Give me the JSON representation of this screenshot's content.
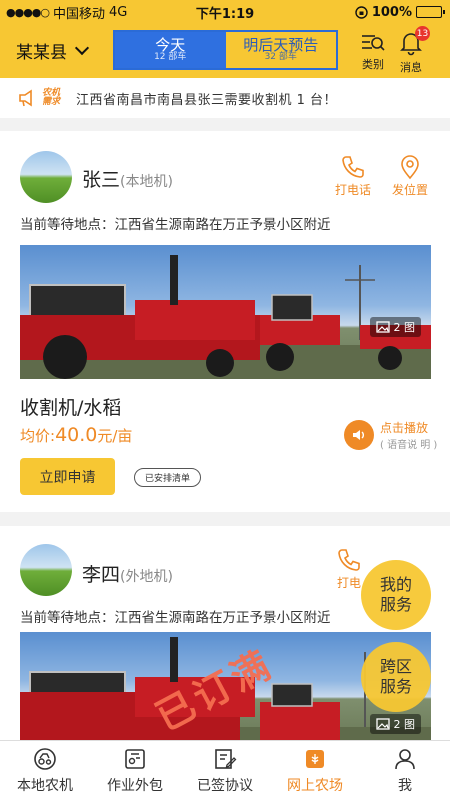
{
  "status": {
    "signal": "●●●●○",
    "carrier": "中国移动",
    "network": "4G",
    "time": "下午1:19",
    "battery": "100%"
  },
  "header": {
    "region": "某某县",
    "tabs": [
      {
        "label": "今天",
        "sub": "12 部车"
      },
      {
        "label": "明后天预告",
        "sub": "32 部车"
      }
    ],
    "category_label": "类别",
    "message_label": "消息",
    "message_badge": "13"
  },
  "notice": {
    "tag": "农机需求",
    "text": "江西省南昌市南昌县张三需要收割机 1 台！"
  },
  "cards": [
    {
      "name": "张三",
      "location_type": "(本地机)",
      "call_label": "打电话",
      "position_label": "发位置",
      "waiting": "当前等待地点：江西省生源南路在万正予景小区附近",
      "photo_count": "2 图",
      "title": "收割机/水稻",
      "price_prefix": "均价:",
      "price_value": "40.0",
      "price_unit": "元/亩",
      "play_label": "点击播放",
      "play_sub": "( 语音说 明 )",
      "apply_label": "立即申请",
      "arranged_label": "已安排清单"
    },
    {
      "name": "李四",
      "location_type": "(外地机)",
      "call_label": "打电",
      "waiting": "当前等待地点：江西省生源南路在万正予景小区附近",
      "photo_count": "2 图",
      "stamp": "已订满"
    }
  ],
  "fabs": {
    "my_service": "我的服务",
    "cross_region": "跨区服务"
  },
  "tabbar": [
    {
      "label": "本地农机"
    },
    {
      "label": "作业外包"
    },
    {
      "label": "已签协议"
    },
    {
      "label": "网上农场"
    },
    {
      "label": "我"
    }
  ],
  "colors": {
    "brand_yellow": "#f7c733",
    "accent_orange": "#ef8a26",
    "active_blue": "#2f70e0"
  }
}
